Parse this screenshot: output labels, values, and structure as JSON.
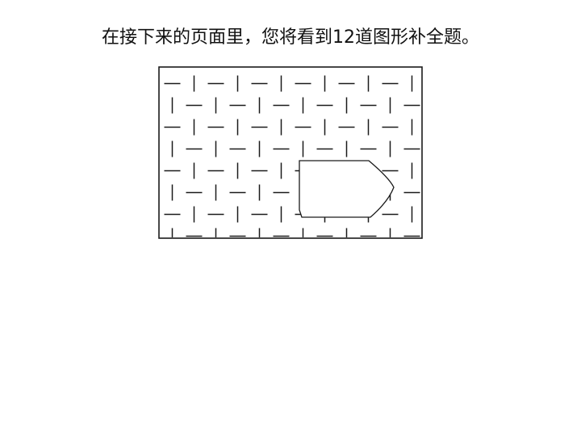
{
  "instruction_text": "在接下来的页面里，您将看到12道图形补全题。",
  "figure": {
    "stroke_color": "#1a1a1a",
    "fill_color": "#ffffff",
    "pattern": "alternating horizontal and vertical dash tiles",
    "missing_piece": "pentagon-shaped blank with curved right point"
  }
}
